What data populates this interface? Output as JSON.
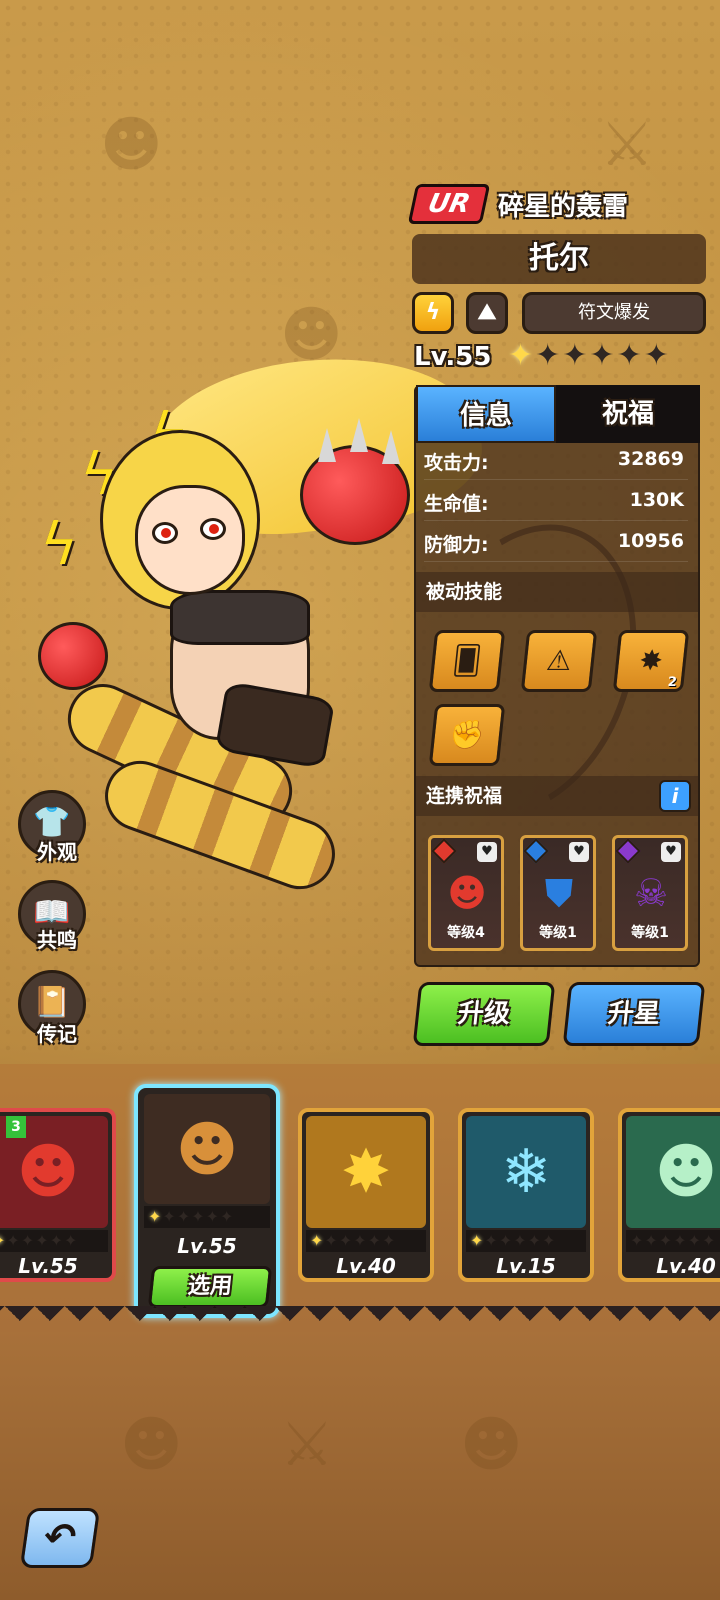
{
  "header": {
    "rarity": "UR",
    "title": "碎星的轰雷",
    "name": "托尔",
    "rune_button": "符文爆发",
    "level": "Lv.55",
    "stars_filled": 1,
    "stars_total": 6
  },
  "element_icons": [
    "lightning-icon",
    "mountain-icon"
  ],
  "tabs": [
    "信息",
    "祝福"
  ],
  "stats": [
    {
      "label": "攻击力:",
      "value": "32869"
    },
    {
      "label": "生命值:",
      "value": "130K"
    },
    {
      "label": "防御力:",
      "value": "10956"
    }
  ],
  "passive": {
    "title": "被动技能",
    "skills": [
      {
        "icon": "cards-dice-icon",
        "count": ""
      },
      {
        "icon": "lightning-triangle-icon",
        "count": ""
      },
      {
        "icon": "burst-icon",
        "count": "2"
      },
      {
        "icon": "fist-icon",
        "count": ""
      }
    ]
  },
  "blessing": {
    "title": "连携祝福",
    "info_label": "i",
    "items": [
      {
        "level": "等级4",
        "symbol": "fire-demon-icon",
        "color": "#e23a2e"
      },
      {
        "level": "等级1",
        "symbol": "shield-icon",
        "color": "#2a7fe0"
      },
      {
        "level": "等级1",
        "symbol": "skull-icon",
        "color": "#8a3acd"
      }
    ]
  },
  "actions": {
    "upgrade": "升级",
    "star_up": "升星"
  },
  "side_menu": [
    {
      "label": "外观",
      "icon": "shirt-icon"
    },
    {
      "label": "共鸣",
      "icon": "book-icon"
    },
    {
      "label": "传记",
      "icon": "journal-icon"
    }
  ],
  "roster": {
    "use_label": "选用",
    "selected_level": "Lv.55",
    "cards": [
      {
        "level": "Lv.55",
        "icon": "red-demon-icon",
        "badge": "3"
      },
      {
        "level": "Lv.40",
        "icon": "yellow-bird-icon",
        "badge": ""
      },
      {
        "level": "Lv.15",
        "icon": "ice-wolf-icon",
        "badge": ""
      },
      {
        "level": "Lv.40",
        "icon": "green-beast-icon",
        "badge": ""
      }
    ]
  },
  "colors": {
    "accent_blue": "#2a7fd8",
    "accent_green": "#4cbf22",
    "rarity_red": "#e4303b",
    "gold": "#e2a43a"
  }
}
